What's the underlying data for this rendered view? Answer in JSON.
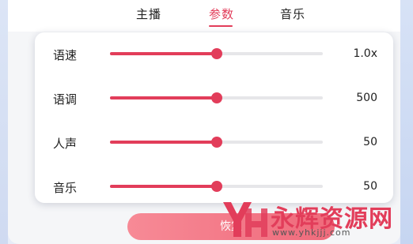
{
  "tabs": [
    {
      "label": "主播",
      "active": false
    },
    {
      "label": "参数",
      "active": true
    },
    {
      "label": "音乐",
      "active": false
    }
  ],
  "params": [
    {
      "label": "语速",
      "value_text": "1.0x",
      "level": 0.5
    },
    {
      "label": "语调",
      "value_text": "500",
      "level": 0.5
    },
    {
      "label": "人声",
      "value_text": "50",
      "level": 0.5
    },
    {
      "label": "音乐",
      "value_text": "50",
      "level": 0.5
    }
  ],
  "reset_button": {
    "label": "恢复"
  },
  "watermark": {
    "title": "永辉资源网",
    "url": "www.yhkjjj.com"
  },
  "colors": {
    "accent": "#e23d5a",
    "track": "#e6e6e9",
    "button": "#f27586"
  }
}
